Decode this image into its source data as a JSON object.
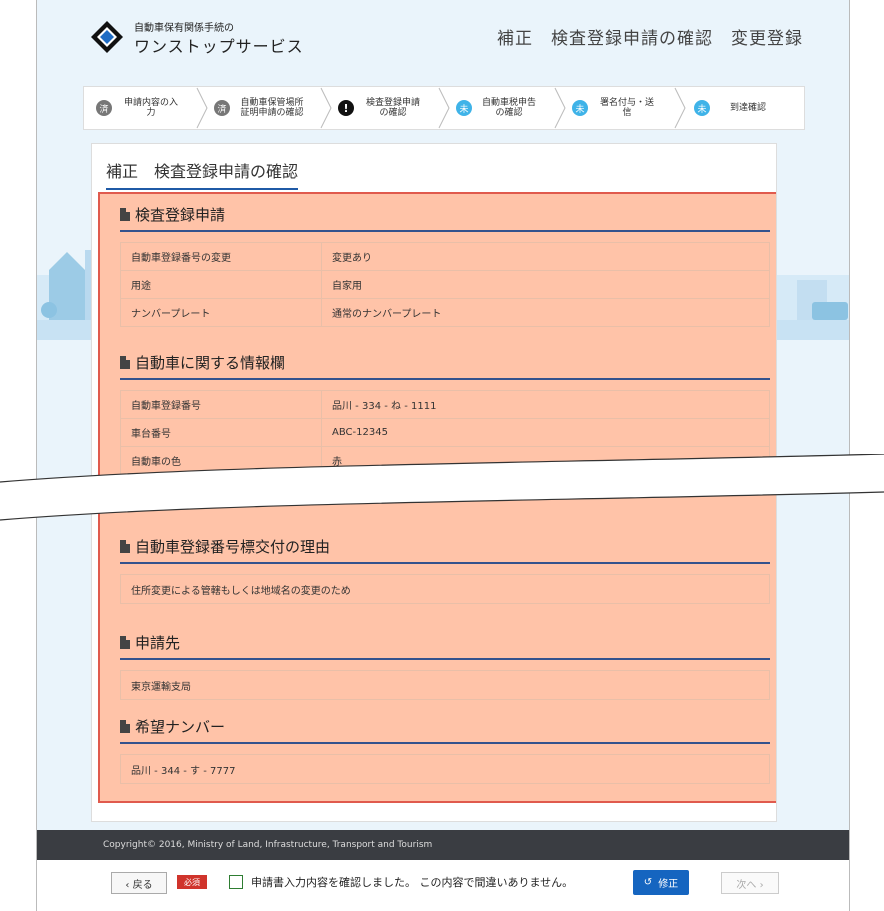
{
  "header": {
    "logo_subtitle": "自動車保有関係手続の",
    "logo_title": "ワンストップサービス",
    "page_heading": "補正　検査登録申請の確認　変更登録"
  },
  "stepper": [
    {
      "badge": "済",
      "label": "申請内容の入力",
      "state": "done"
    },
    {
      "badge": "済",
      "label": "自動車保管場所証明申請の確認",
      "state": "done"
    },
    {
      "badge": "!",
      "label": "検査登録申請の確認",
      "state": "current"
    },
    {
      "badge": "未",
      "label": "自動車税申告の確認",
      "state": "todo"
    },
    {
      "badge": "未",
      "label": "署名付与・送信",
      "state": "todo"
    },
    {
      "badge": "未",
      "label": "到達確認",
      "state": "todo"
    }
  ],
  "panel_title": "補正　検査登録申請の確認",
  "sections": {
    "inspection": {
      "title": "検査登録申請",
      "rows": [
        {
          "label": "自動車登録番号の変更",
          "value": "変更あり"
        },
        {
          "label": "用途",
          "value": "自家用"
        },
        {
          "label": "ナンバープレート",
          "value": "通常のナンバープレート"
        }
      ]
    },
    "vehicle": {
      "title": "自動車に関する情報欄",
      "rows": [
        {
          "label": "自動車登録番号",
          "value": "品川 - 334 - ね - 1111"
        },
        {
          "label": "車台番号",
          "value": "ABC-12345"
        },
        {
          "label": "自動車の色",
          "value": "赤"
        }
      ]
    },
    "reason": {
      "title": "自動車登録番号標交付の理由",
      "value": "住所変更による管轄もしくは地域名の変更のため"
    },
    "destination": {
      "title": "申請先",
      "value": "東京運輸支局"
    },
    "desired_number": {
      "title": "希望ナンバー",
      "value": "品川 - 344 - す - 7777"
    }
  },
  "footer": {
    "copyright": "Copyright© 2016, Ministry of Land, Infrastructure, Transport and Tourism",
    "back_label": "‹ 戻る",
    "required_label": "必須",
    "confirm_text": "申請書入力内容を確認しました。 この内容で間違いありません。",
    "fix_label": "修正",
    "next_label": "次へ ›"
  },
  "colors": {
    "accent": "#1565c0",
    "highlight_fill": "#ffc3a8",
    "highlight_border": "#e05a4d",
    "required": "#d0342c",
    "step_todo": "#3fb3e8"
  }
}
